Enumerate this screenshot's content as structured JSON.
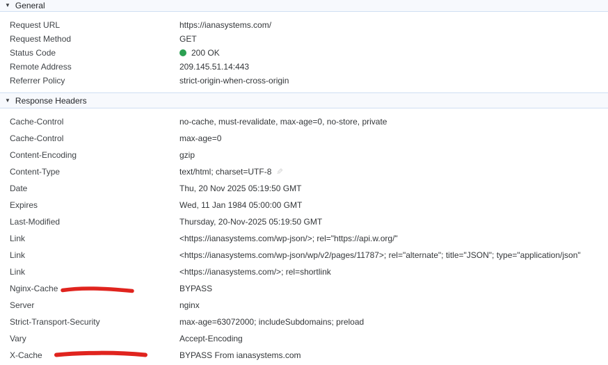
{
  "icons": {
    "disclosure": "▼",
    "edit_pencil": "✎"
  },
  "colors": {
    "status_green": "#2BA052",
    "annotation_red": "#E0241E",
    "section_header_bg": "#F7F9FD",
    "section_header_border": "#CFDFF2"
  },
  "sections": {
    "general": {
      "title": "General",
      "rows": [
        {
          "name": "Request URL",
          "value": "https://ianasystems.com/"
        },
        {
          "name": "Request Method",
          "value": "GET"
        },
        {
          "name": "Status Code",
          "value": "200 OK"
        },
        {
          "name": "Remote Address",
          "value": "209.145.51.14:443"
        },
        {
          "name": "Referrer Policy",
          "value": "strict-origin-when-cross-origin"
        }
      ]
    },
    "response": {
      "title": "Response Headers",
      "rows": [
        {
          "name": "Cache-Control",
          "value": "no-cache, must-revalidate, max-age=0, no-store, private"
        },
        {
          "name": "Cache-Control",
          "value": "max-age=0"
        },
        {
          "name": "Content-Encoding",
          "value": "gzip"
        },
        {
          "name": "Content-Type",
          "value": "text/html; charset=UTF-8"
        },
        {
          "name": "Date",
          "value": "Thu, 20 Nov 2025 05:19:50 GMT"
        },
        {
          "name": "Expires",
          "value": "Wed, 11 Jan 1984 05:00:00 GMT"
        },
        {
          "name": "Last-Modified",
          "value": "Thursday, 20-Nov-2025 05:19:50 GMT"
        },
        {
          "name": "Link",
          "value": "<https://ianasystems.com/wp-json/>; rel=\"https://api.w.org/\""
        },
        {
          "name": "Link",
          "value": "<https://ianasystems.com/wp-json/wp/v2/pages/11787>; rel=\"alternate\"; title=\"JSON\"; type=\"application/json\""
        },
        {
          "name": "Link",
          "value": "<https://ianasystems.com/>; rel=shortlink"
        },
        {
          "name": "Nginx-Cache",
          "value": "BYPASS"
        },
        {
          "name": "Server",
          "value": "nginx"
        },
        {
          "name": "Strict-Transport-Security",
          "value": "max-age=63072000; includeSubdomains; preload"
        },
        {
          "name": "Vary",
          "value": "Accept-Encoding"
        },
        {
          "name": "X-Cache",
          "value": "BYPASS From ianasystems.com"
        }
      ]
    }
  }
}
